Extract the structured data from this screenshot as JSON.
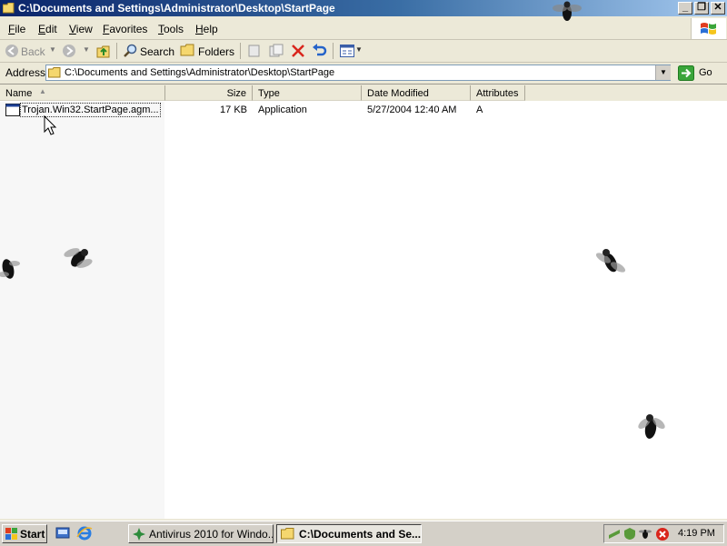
{
  "window": {
    "title": "C:\\Documents and Settings\\Administrator\\Desktop\\StartPage",
    "controls": [
      "minimize",
      "restore",
      "close"
    ]
  },
  "menu": [
    "File",
    "Edit",
    "View",
    "Favorites",
    "Tools",
    "Help"
  ],
  "toolbar": {
    "back_label": "Back",
    "search_label": "Search",
    "folders_label": "Folders"
  },
  "address": {
    "label": "Address",
    "value": "C:\\Documents and Settings\\Administrator\\Desktop\\StartPage",
    "go_label": "Go"
  },
  "columns": [
    "Name",
    "Size",
    "Type",
    "Date Modified",
    "Attributes"
  ],
  "files": [
    {
      "name": "Trojan.Win32.StartPage.agm...",
      "size": "17 KB",
      "type": "Application",
      "modified": "5/27/2004 12:40 AM",
      "attributes": "A"
    }
  ],
  "taskbar": {
    "start_label": "Start",
    "tasks": [
      "Antivirus 2010 for Windo...",
      "C:\\Documents and Se..."
    ],
    "clock": "4:19 PM"
  },
  "colors": {
    "titlebar": "#0a246a",
    "face": "#ece9d8"
  },
  "icons": [
    "folder-icon",
    "application-icon",
    "fly-icon",
    "windows-logo-icon"
  ]
}
